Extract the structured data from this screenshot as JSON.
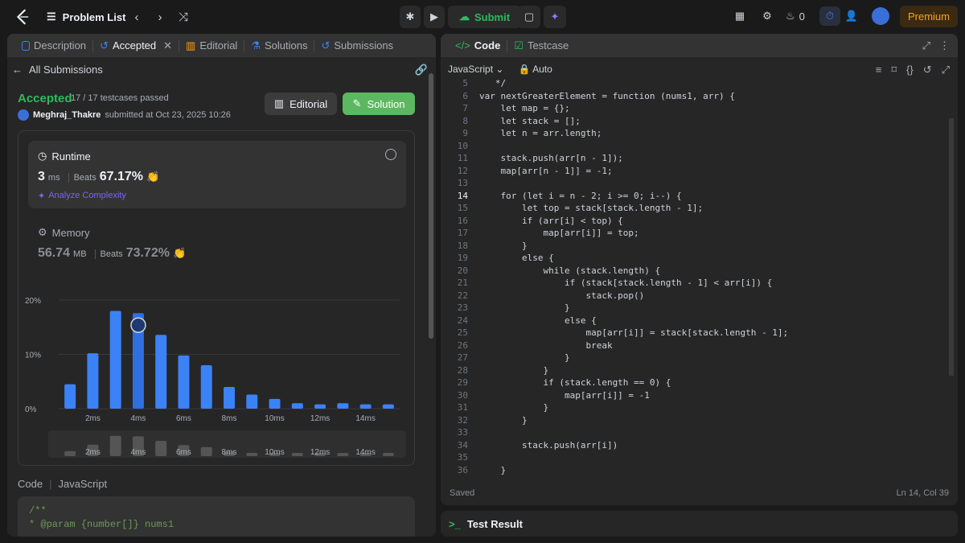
{
  "topbar": {
    "problem_list": "Problem List",
    "submit": "Submit",
    "streak": "0",
    "premium": "Premium"
  },
  "left_tabs": [
    {
      "label": "Description"
    },
    {
      "label": "Accepted"
    },
    {
      "label": "Editorial"
    },
    {
      "label": "Solutions"
    },
    {
      "label": "Submissions"
    }
  ],
  "all_submissions": "All Submissions",
  "result": {
    "status": "Accepted",
    "passed": "17 / 17 testcases passed",
    "user": "Meghraj_Thakre",
    "submitted": "submitted at Oct 23, 2025 10:26",
    "editorial_btn": "Editorial",
    "solution_btn": "Solution"
  },
  "runtime": {
    "title": "Runtime",
    "value": "3",
    "unit": "ms",
    "beats_label": "Beats",
    "beats": "67.17%",
    "analyze": "Analyze Complexity"
  },
  "memory": {
    "title": "Memory",
    "value": "56.74",
    "unit": "MB",
    "beats_label": "Beats",
    "beats": "73.72%"
  },
  "chart_data": {
    "type": "bar",
    "yticks": [
      "20%",
      "10%",
      "0%"
    ],
    "ylim": [
      0,
      20
    ],
    "xticks": [
      "2ms",
      "4ms",
      "6ms",
      "8ms",
      "10ms",
      "12ms",
      "14ms"
    ],
    "values": [
      4.5,
      10.2,
      18.0,
      17.6,
      13.6,
      9.8,
      8.0,
      4.0,
      2.6,
      1.8,
      1.0,
      0.8,
      1.0,
      0.8,
      0.8
    ],
    "highlight_index": 3
  },
  "code_section": {
    "label": "Code",
    "lang": "JavaScript",
    "line1": "/**",
    "line2": " * @param {number[]} nums1"
  },
  "editor": {
    "tab_code": "Code",
    "tab_testcase": "Testcase",
    "language": "JavaScript",
    "auto": "Auto",
    "saved": "Saved",
    "cursor": "Ln 14, Col 39",
    "current_line": 14,
    "lines": [
      {
        "n": "5",
        "t": "   */"
      },
      {
        "n": "6",
        "t": "var nextGreaterElement = function (nums1, arr) {"
      },
      {
        "n": "7",
        "t": "    let map = {};"
      },
      {
        "n": "8",
        "t": "    let stack = [];"
      },
      {
        "n": "9",
        "t": "    let n = arr.length;"
      },
      {
        "n": "10",
        "t": ""
      },
      {
        "n": "11",
        "t": "    stack.push(arr[n - 1]);"
      },
      {
        "n": "12",
        "t": "    map[arr[n - 1]] = -1;"
      },
      {
        "n": "13",
        "t": ""
      },
      {
        "n": "14",
        "t": "    for (let i = n - 2; i >= 0; i--) {"
      },
      {
        "n": "15",
        "t": "        let top = stack[stack.length - 1];"
      },
      {
        "n": "16",
        "t": "        if (arr[i] < top) {"
      },
      {
        "n": "17",
        "t": "            map[arr[i]] = top;"
      },
      {
        "n": "18",
        "t": "        }"
      },
      {
        "n": "19",
        "t": "        else {"
      },
      {
        "n": "20",
        "t": "            while (stack.length) {"
      },
      {
        "n": "21",
        "t": "                if (stack[stack.length - 1] < arr[i]) {"
      },
      {
        "n": "22",
        "t": "                    stack.pop()"
      },
      {
        "n": "23",
        "t": "                }"
      },
      {
        "n": "24",
        "t": "                else {"
      },
      {
        "n": "25",
        "t": "                    map[arr[i]] = stack[stack.length - 1];"
      },
      {
        "n": "26",
        "t": "                    break"
      },
      {
        "n": "27",
        "t": "                }"
      },
      {
        "n": "28",
        "t": "            }"
      },
      {
        "n": "29",
        "t": "            if (stack.length == 0) {"
      },
      {
        "n": "30",
        "t": "                map[arr[i]] = -1"
      },
      {
        "n": "31",
        "t": "            }"
      },
      {
        "n": "32",
        "t": "        }"
      },
      {
        "n": "33",
        "t": ""
      },
      {
        "n": "34",
        "t": "        stack.push(arr[i])"
      },
      {
        "n": "35",
        "t": ""
      },
      {
        "n": "36",
        "t": "    }"
      }
    ]
  },
  "test_result": "Test Result",
  "colors": {
    "accent": "#2cbb5d",
    "bar": "#3b82f6",
    "premium": "#ffa116"
  }
}
